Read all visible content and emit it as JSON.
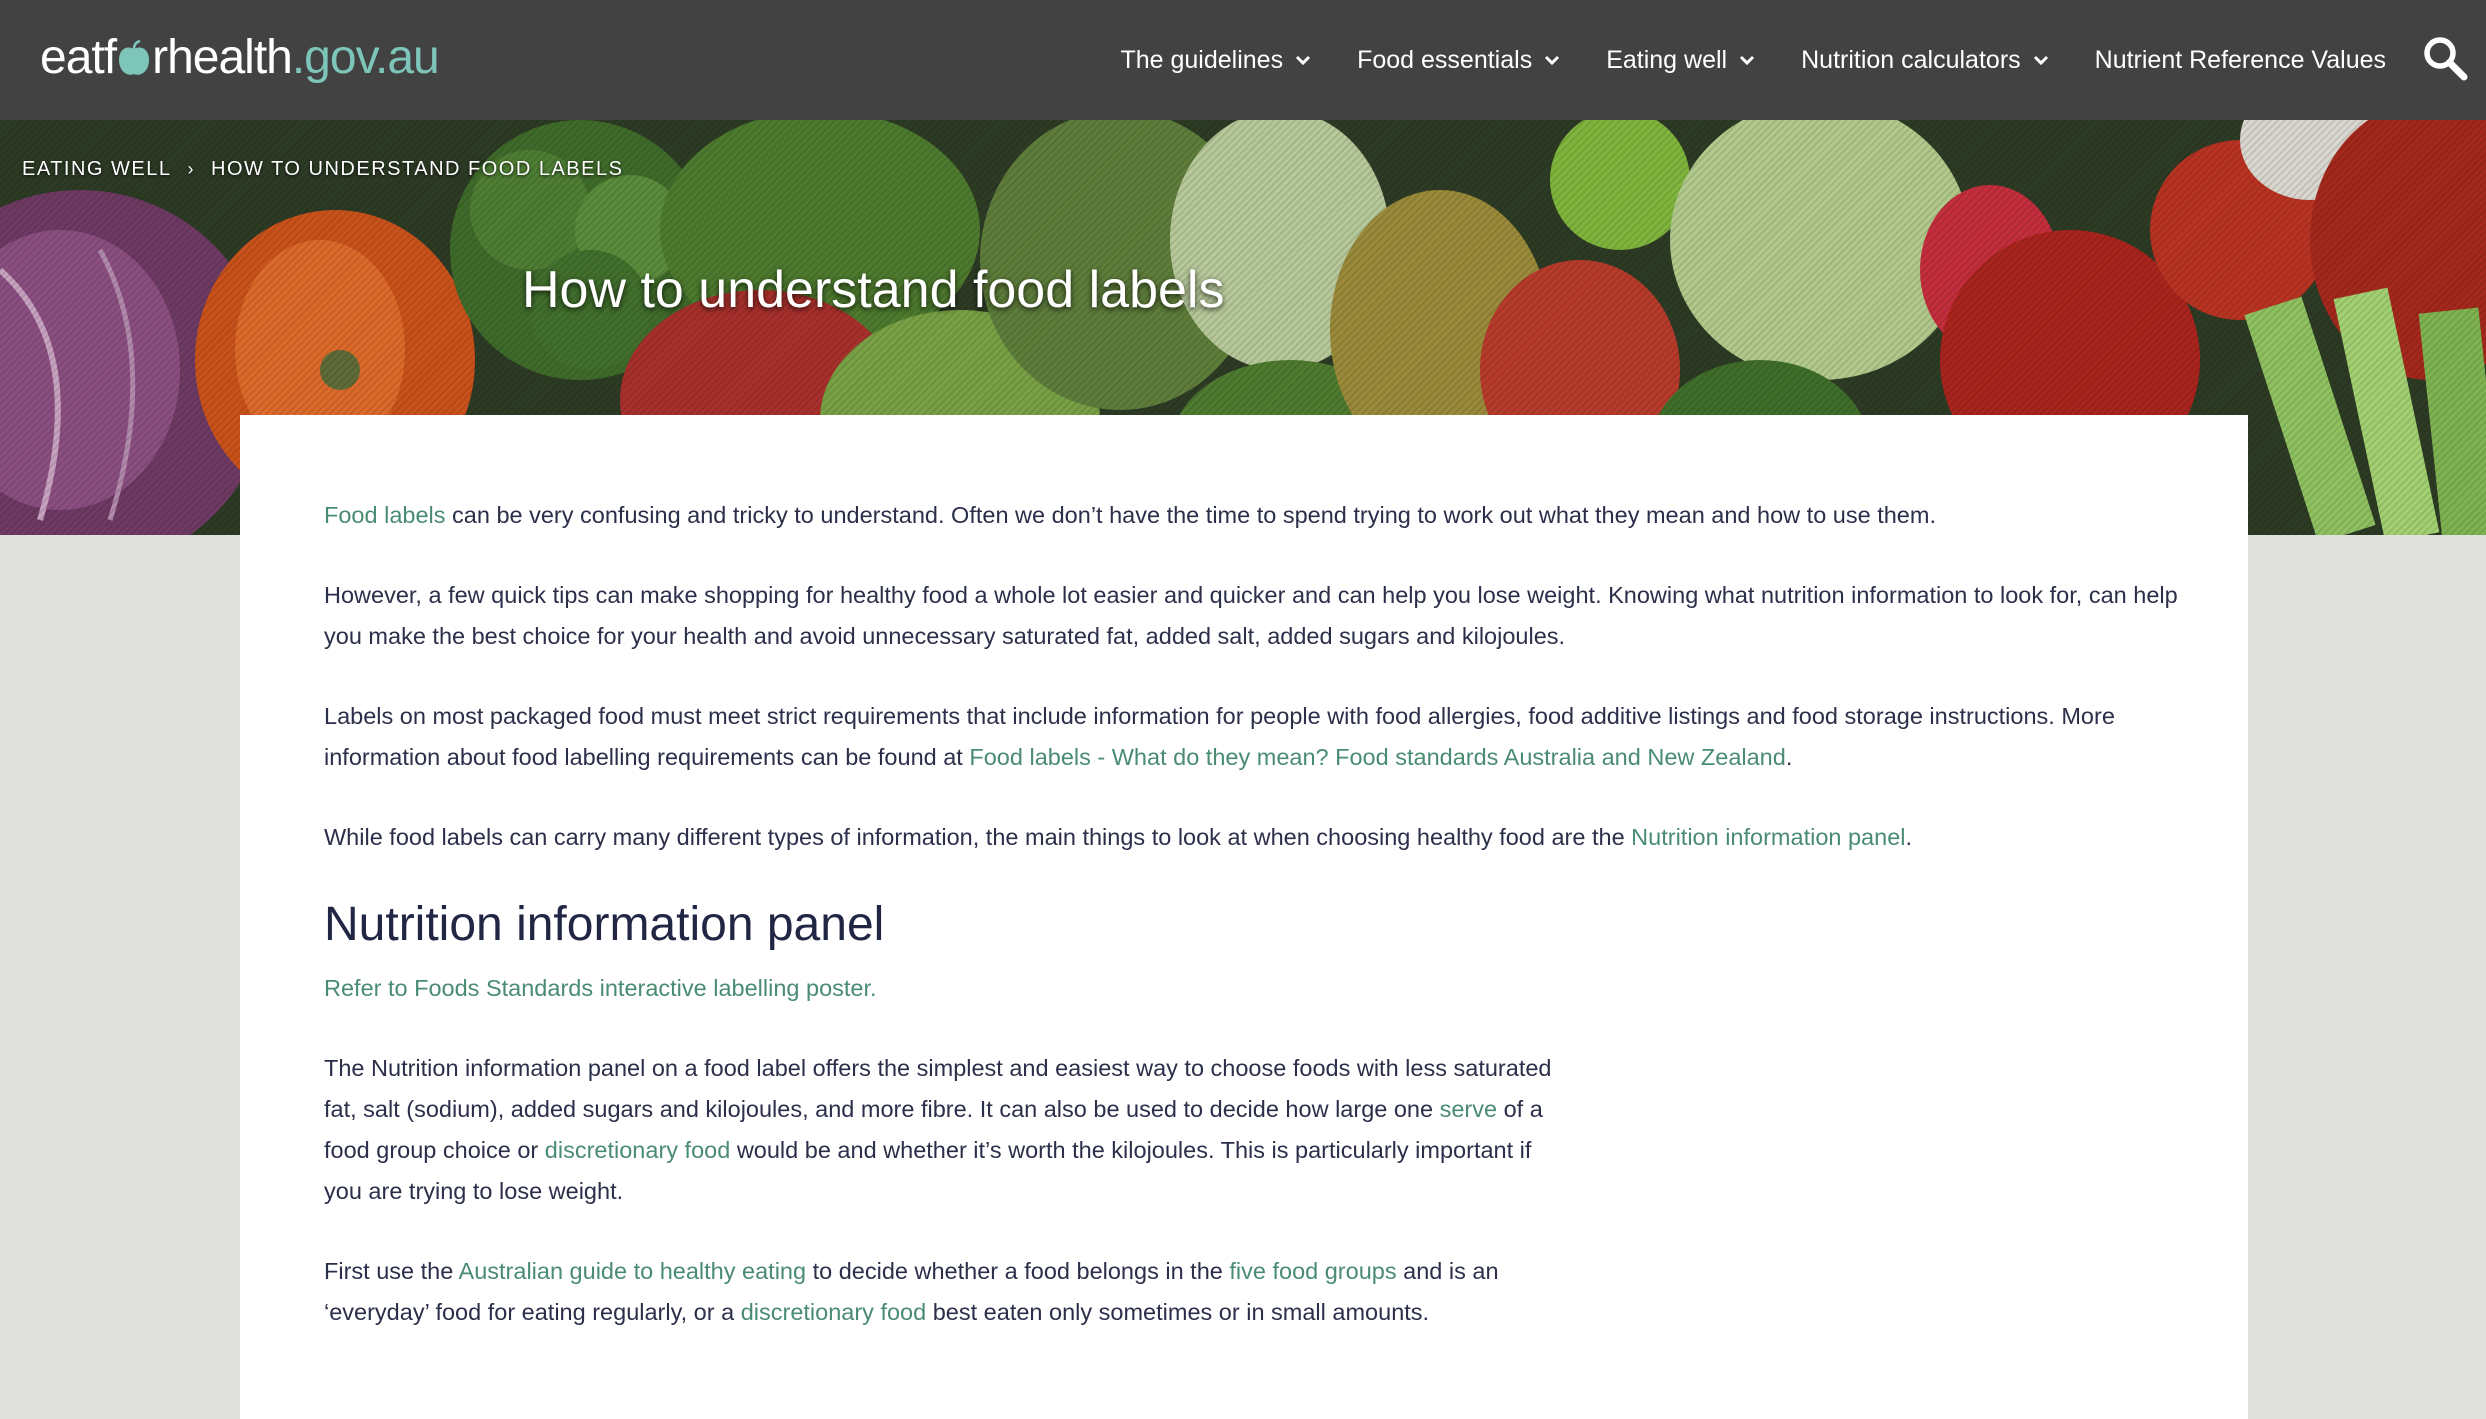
{
  "header": {
    "logo": {
      "part1": "eat",
      "part2": "rhealth",
      "domain": ".gov.au"
    },
    "nav": [
      {
        "label": "The guidelines",
        "has_dropdown": true
      },
      {
        "label": "Food essentials",
        "has_dropdown": true
      },
      {
        "label": "Eating well",
        "has_dropdown": true
      },
      {
        "label": "Nutrition calculators",
        "has_dropdown": true
      },
      {
        "label": "Nutrient Reference Values",
        "has_dropdown": false
      }
    ],
    "search_icon": "search-icon"
  },
  "breadcrumb": {
    "items": [
      "EATING WELL",
      "HOW TO UNDERSTAND FOOD LABELS"
    ],
    "separator": "›"
  },
  "hero": {
    "title": "How to understand food labels"
  },
  "content": {
    "p1": {
      "link": "Food labels",
      "text": " can be very confusing and tricky to understand. Often we don’t have the time to spend trying to work out what they mean and how to use them."
    },
    "p2": "However, a few quick tips can make shopping for healthy food a whole lot easier and quicker and can help you lose weight. Knowing what nutrition information to look for, can help you make the best choice for your health and avoid unnecessary saturated fat, added salt, added sugars and kilojoules.",
    "p3": {
      "text": "Labels on most packaged food must meet strict requirements that include information for people with food allergies, food additive listings and food storage instructions. More information about food labelling requirements can be found at ",
      "link": "Food labels - What do they mean? Food standards Australia and New Zealand",
      "end": "."
    },
    "p4": {
      "text": "While food labels can carry many different types of information, the main things to look at when choosing healthy food are the ",
      "link": "Nutrition information panel",
      "end": "."
    },
    "section_heading": "Nutrition information panel",
    "poster_link": "Refer to Foods Standards interactive labelling poster.",
    "p5": {
      "t1": "The Nutrition information panel on a food label offers the simplest and easiest way to choose foods with less saturated fat, salt (sodium), added sugars and kilojoules, and more fibre. It can also be used to decide how large one ",
      "link1": "serve",
      "t2": " of a food group choice or ",
      "link2": "discretionary food",
      "t3": " would be and whether it’s worth the kilojoules. This is particularly important if you are trying to lose weight."
    },
    "p6": {
      "t1": "First use the ",
      "link1": "Australian guide to healthy eating",
      "t2": " to decide whether a food belongs in the ",
      "link2": "five food groups",
      "t3": " and is an ‘everyday’ food for eating regularly, or a ",
      "link3": "discretionary food",
      "t4": " best eaten only sometimes or in small amounts."
    }
  },
  "colors": {
    "header_bg": "#424242",
    "link": "#4a8c72",
    "logo_accent": "#7ec5b9",
    "page_bg": "#e0e1de",
    "text": "#2c2f4a"
  }
}
